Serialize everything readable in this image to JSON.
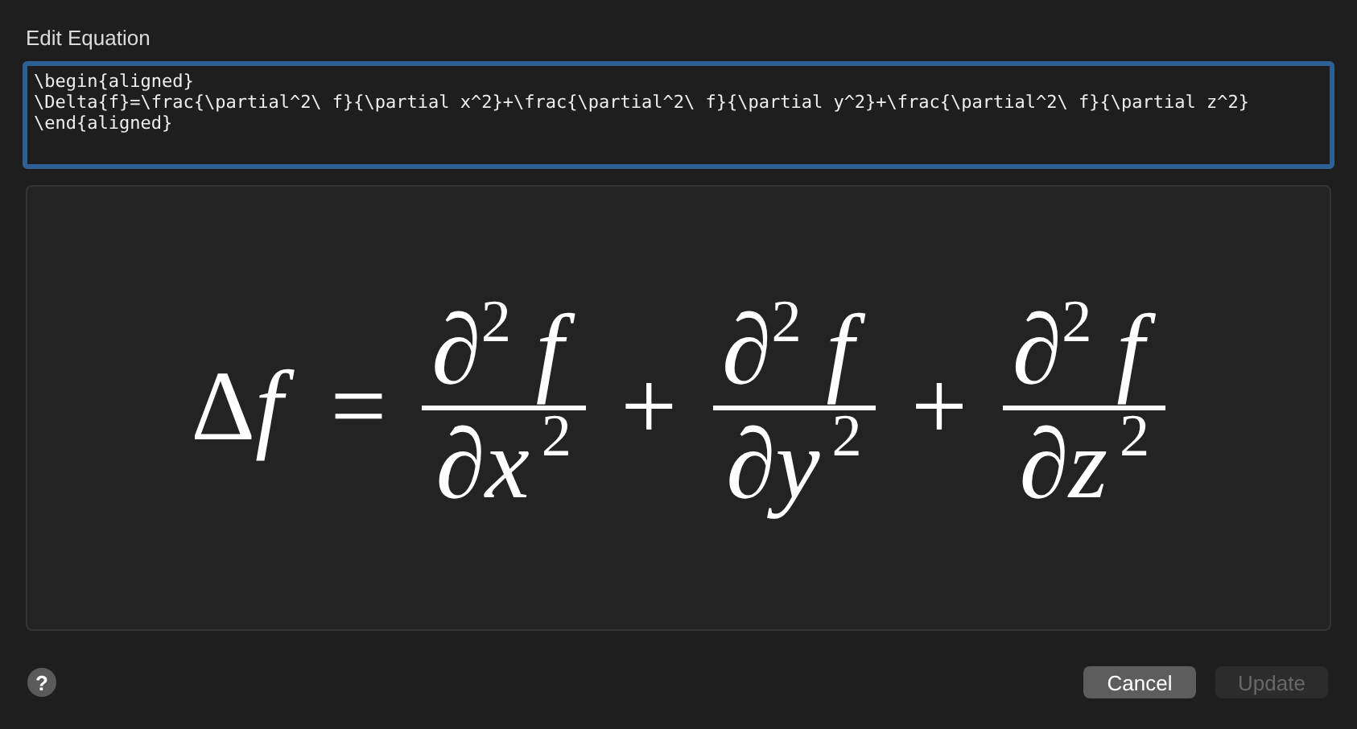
{
  "dialog": {
    "title": "Edit Equation"
  },
  "source": {
    "value": "\\begin{aligned}\n\\Delta{f}=\\frac{\\partial^2\\ f}{\\partial x^2}+\\frac{\\partial^2\\ f}{\\partial y^2}+\\frac{\\partial^2\\ f}{\\partial z^2}\n\\end{aligned}"
  },
  "preview": {
    "lhs": "Δ",
    "lhs_variable": "f",
    "equals": "=",
    "terms": [
      {
        "numerator": "∂$^{2}$ *f*",
        "denominator": "∂*x*$^{2}$"
      },
      {
        "operator": "+",
        "numerator": "∂$^{2}$ *f*",
        "denominator": "∂*y*$^{2}$"
      },
      {
        "operator": "+",
        "numerator": "∂$^{2}$ *f*",
        "denominator": "∂*z*$^{2}$"
      }
    ]
  },
  "help": {
    "label": "?"
  },
  "buttons": [
    {
      "label": "Cancel",
      "disabled": false
    },
    {
      "label": "Update",
      "disabled": true
    }
  ]
}
